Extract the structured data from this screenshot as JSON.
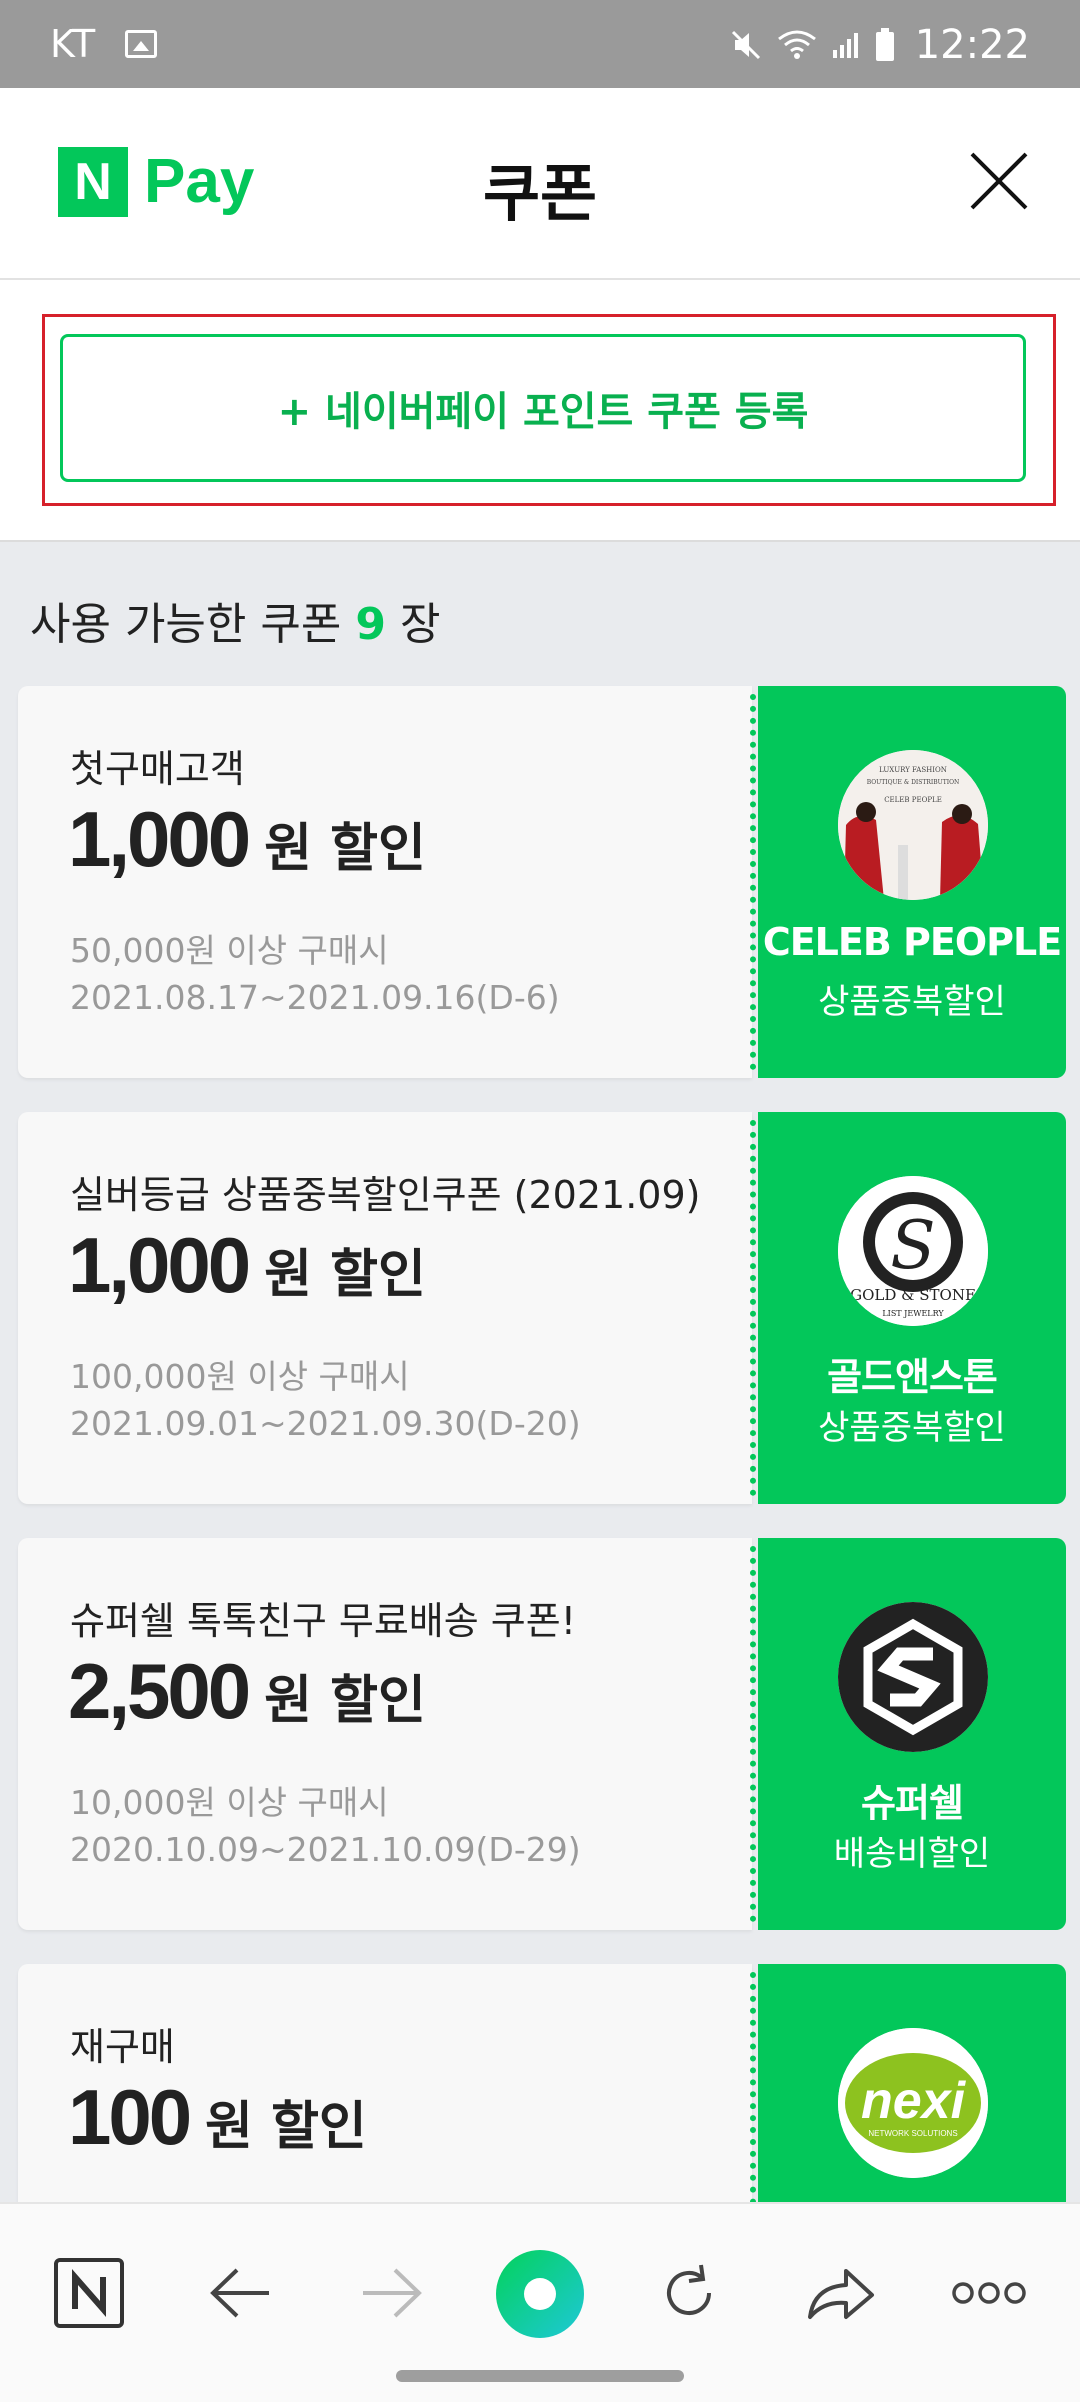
{
  "status_bar": {
    "carrier": "KT",
    "time": "12:22"
  },
  "header": {
    "logo_n": "N",
    "logo_pay": "Pay",
    "title": "쿠폰"
  },
  "register": {
    "label": "+ 네이버페이 포인트 쿠폰 등록"
  },
  "count": {
    "prefix": "사용 가능한 쿠폰",
    "number": "9",
    "suffix": "장"
  },
  "coupons": [
    {
      "name": "첫구매고객",
      "amount": "1,000",
      "unit": "원 할인",
      "condition": "50,000원 이상 구매시",
      "period": "2021.08.17~2021.09.16(D-6)",
      "brand": "CELEB PEOPLE",
      "brand_type": "상품중복할인",
      "logo_text": "CELEB PEOPLE"
    },
    {
      "name": "실버등급 상품중복할인쿠폰 (2021.09)",
      "amount": "1,000",
      "unit": "원 할인",
      "condition": "100,000원 이상 구매시",
      "period": "2021.09.01~2021.09.30(D-20)",
      "brand": "골드앤스톤",
      "brand_type": "상품중복할인",
      "logo_text": "GOLD & STONE"
    },
    {
      "name": "슈퍼쉘 톡톡친구 무료배송 쿠폰!",
      "amount": "2,500",
      "unit": "원 할인",
      "condition": "10,000원 이상 구매시",
      "period": "2020.10.09~2021.10.09(D-29)",
      "brand": "슈퍼쉘",
      "brand_type": "배송비할인",
      "logo_text": "S"
    },
    {
      "name": "재구매",
      "amount": "100",
      "unit": "원 할인",
      "condition": "",
      "period": "",
      "brand": "",
      "brand_type": "",
      "logo_text": "nexi"
    }
  ],
  "bottom_nav": {
    "items": [
      "naver-home",
      "back",
      "forward",
      "green-dot",
      "refresh",
      "share",
      "more"
    ]
  },
  "colors": {
    "brand_green": "#03c75a",
    "highlight_red": "#d6202a",
    "background": "#e9ebee"
  }
}
